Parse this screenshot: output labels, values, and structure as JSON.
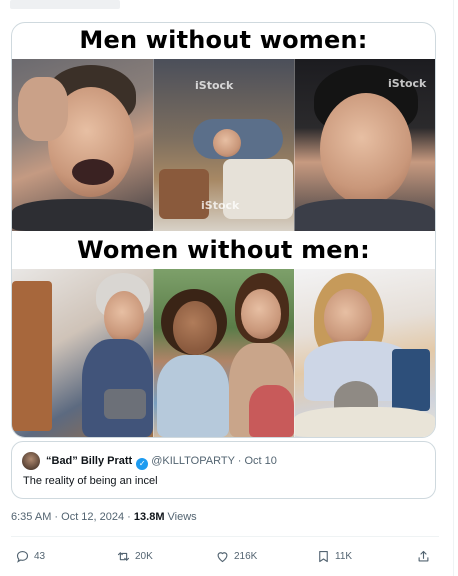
{
  "meme": {
    "caption_top": "Men without women:",
    "caption_bottom": "Women without men:",
    "watermark_1": "iStock",
    "watermark_2": "iStock",
    "watermark_3": "iStock"
  },
  "quoted_tweet": {
    "display_name": "“Bad” Billy Pratt",
    "verified_icon": "verified-badge-icon",
    "handle": "@KILLTOPARTY",
    "separator": "·",
    "date": "Oct 10",
    "text": "The reality of being an incel"
  },
  "meta": {
    "timestamp": "6:35 AM · Oct 12, 2024 · ",
    "views_count": "13.8M",
    "views_label": " Views"
  },
  "actions": {
    "replies": "43",
    "reposts": "20K",
    "likes": "216K",
    "bookmarks": "11K"
  },
  "colors": {
    "accent": "#1d9bf0",
    "secondary_text": "#536471",
    "border": "#cfd9de"
  }
}
